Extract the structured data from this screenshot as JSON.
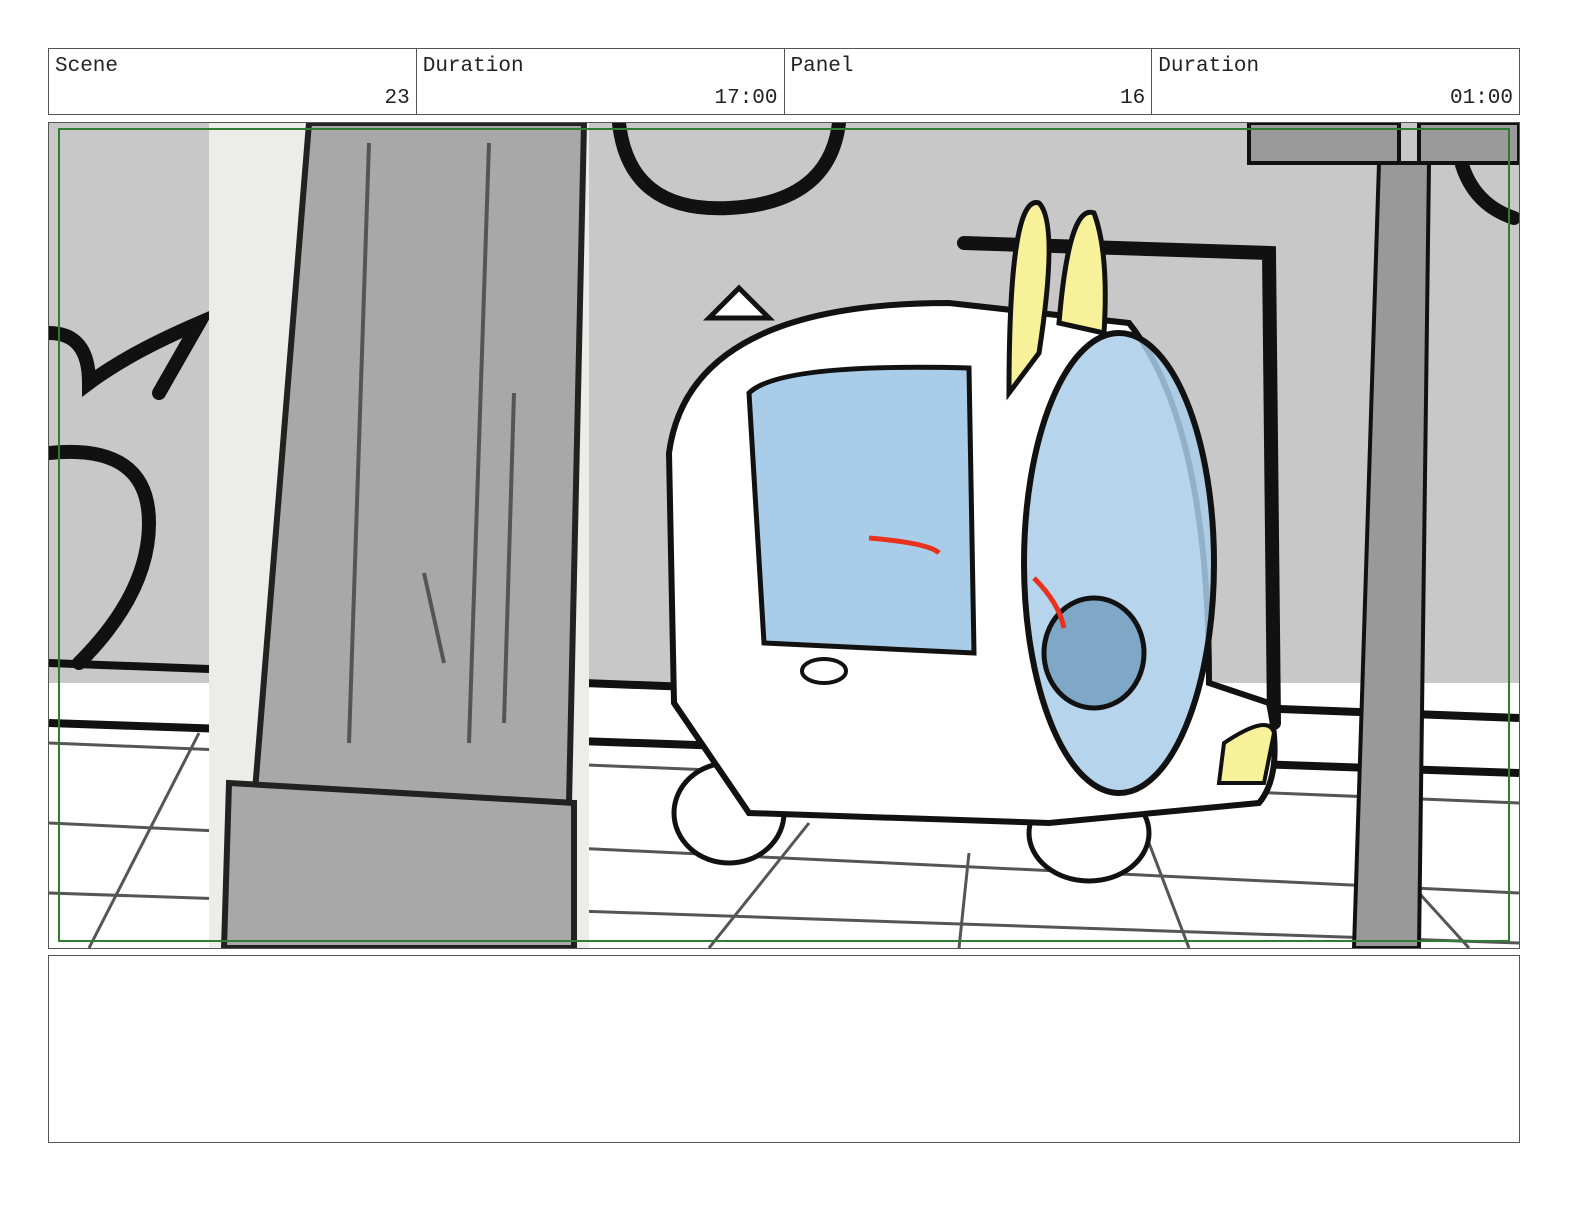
{
  "header": {
    "scene_label": "Scene",
    "scene_value": "23",
    "scene_duration_label": "Duration",
    "scene_duration_value": "17:00",
    "panel_label": "Panel",
    "panel_value": "16",
    "panel_duration_label": "Duration",
    "panel_duration_value": "01:00"
  },
  "colors": {
    "safe_frame": "#2e7d32",
    "wall": "#c8c8c8",
    "pillar": "#a8a8a8",
    "glass": "#a9cce8",
    "ears": "#f7f29a",
    "mark": "#e8321e"
  },
  "notes": {
    "text": ""
  }
}
